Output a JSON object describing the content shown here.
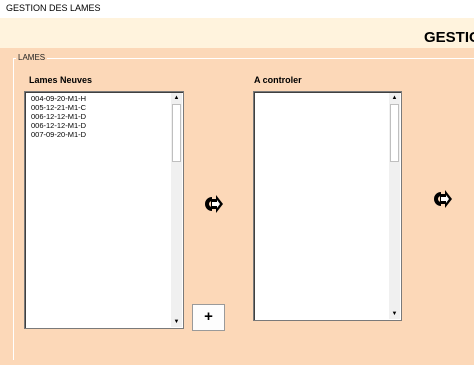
{
  "window": {
    "title": "GESTION DES LAMES"
  },
  "banner": {
    "heading": "GESTIC"
  },
  "frame": {
    "label": "LAMES"
  },
  "lists": {
    "new": {
      "label": "Lames Neuves",
      "items": [
        "004-09-20-M1-H",
        "005-12-21-M1-C",
        "006-12-12-M1-D",
        "006-12-12-M1-D",
        "007-09-20-M1-D"
      ]
    },
    "control": {
      "label": "A controler",
      "items": []
    }
  },
  "buttons": {
    "add_label": "+",
    "move_to_control_icon": "right-arrow-icon",
    "move_next_icon": "right-arrow-icon"
  },
  "scroll": {
    "up_glyph": "▲",
    "down_glyph": "▼"
  },
  "colors": {
    "panel_bg": "#fcd8b8",
    "banner_bg": "#fff3dd",
    "arrow_icon": "#000000"
  }
}
